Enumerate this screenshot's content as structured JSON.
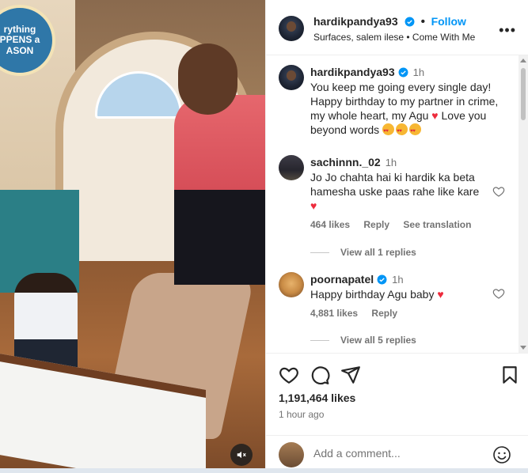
{
  "post": {
    "author": "hardikpandya93",
    "follow_label": "Follow",
    "separator": "•",
    "subtitle": "Surfaces, salem ilese • Come With Me",
    "more_label": "•••"
  },
  "media": {
    "badge_text": "rything PPENS a ASON",
    "muted": true
  },
  "comments": [
    {
      "username": "hardikpandya93",
      "verified": true,
      "time": "1h",
      "lines": [
        "You keep me going every single day!",
        "Happy birthday to my partner in crime,",
        "my whole heart, my Agu",
        "Love you",
        "beyond words"
      ],
      "heart_after_line": 2,
      "emoji_count": 3
    },
    {
      "username": "sachinnn._02",
      "verified": false,
      "time": "1h",
      "lines": [
        "Jo Jo chahta hai ki hardik ka beta",
        "hamesha uske paas rahe like kare"
      ],
      "likes": "464 likes",
      "reply_label": "Reply",
      "translation_label": "See translation",
      "view_replies": "View all 1 replies"
    },
    {
      "username": "poornapatel",
      "verified": true,
      "time": "1h",
      "text": "Happy birthday Agu baby",
      "likes": "4,881 likes",
      "reply_label": "Reply",
      "view_replies": "View all 5 replies"
    }
  ],
  "actions": {
    "likes": "1,191,464 likes",
    "time_ago": "1 hour ago"
  },
  "comment_box": {
    "placeholder": "Add a comment..."
  },
  "colors": {
    "accent": "#0095f6",
    "heart": "#ed2b3c",
    "muted_text": "#737373"
  },
  "icons": [
    "verified-icon",
    "more-icon",
    "heart-icon",
    "comment-icon",
    "share-icon",
    "bookmark-icon",
    "emoji-icon",
    "mute-icon"
  ]
}
